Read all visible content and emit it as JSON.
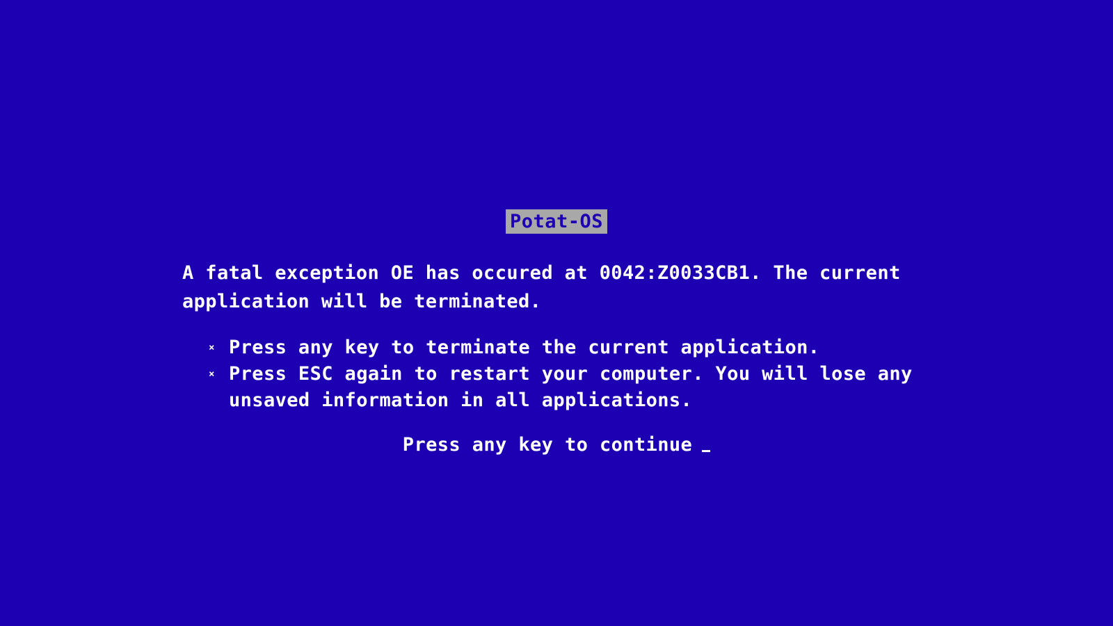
{
  "screen": {
    "background_color": "#1e00b3",
    "text_color": "#ffffff",
    "title_bg_color": "#a8a8a8"
  },
  "title": "Potat-OS",
  "message": "A fatal exception OE has occured at 0042:Z0033CB1. The current application will be terminated.",
  "bullets": [
    {
      "marker": "×",
      "text": "Press any key to terminate the current application."
    },
    {
      "marker": "×",
      "text": "Press ESC again to restart your computer. You will lose any unsaved information in all applications."
    }
  ],
  "continue_prompt": "Press any key to continue",
  "cursor": "_"
}
